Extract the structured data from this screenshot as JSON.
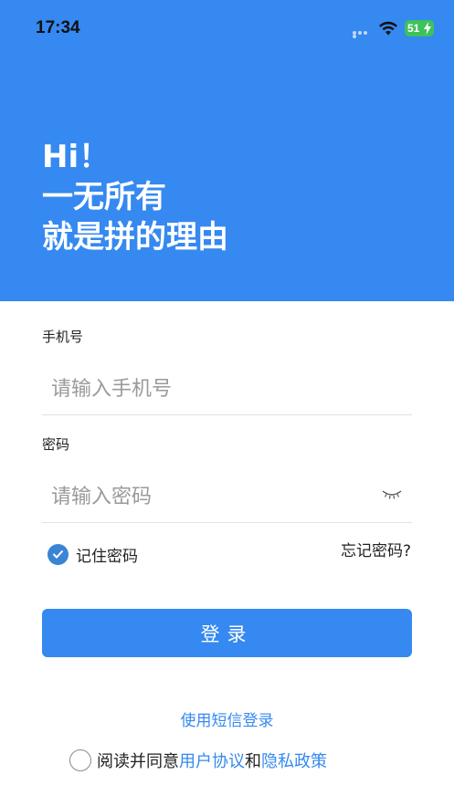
{
  "status_bar": {
    "time": "17:34",
    "battery_level": "51",
    "icons": [
      "signal-dots-icon",
      "wifi-icon",
      "battery-charging-icon"
    ]
  },
  "header": {
    "greeting_line1": "Hi！",
    "greeting_line2": "一无所有",
    "greeting_line3": "就是拼的理由",
    "background_color": "#3589F0"
  },
  "form": {
    "phone_label": "手机号",
    "phone_placeholder": "请输入手机号",
    "phone_value": "",
    "password_label": "密码",
    "password_placeholder": "请输入密码",
    "password_value": "",
    "password_toggle_icon": "eye-closed-icon",
    "remember_label": "记住密码",
    "remember_checked": true,
    "forgot_label": "忘记密码?",
    "login_button": "登录"
  },
  "footer": {
    "sms_login": "使用短信登录",
    "agree_prefix": "阅读并同意",
    "user_agreement": "用户协议",
    "and": "和",
    "privacy_policy": "隐私政策",
    "agree_checked": false
  },
  "colors": {
    "accent": "#3589F0",
    "check": "#3A84D6",
    "battery": "#3EC25B"
  }
}
